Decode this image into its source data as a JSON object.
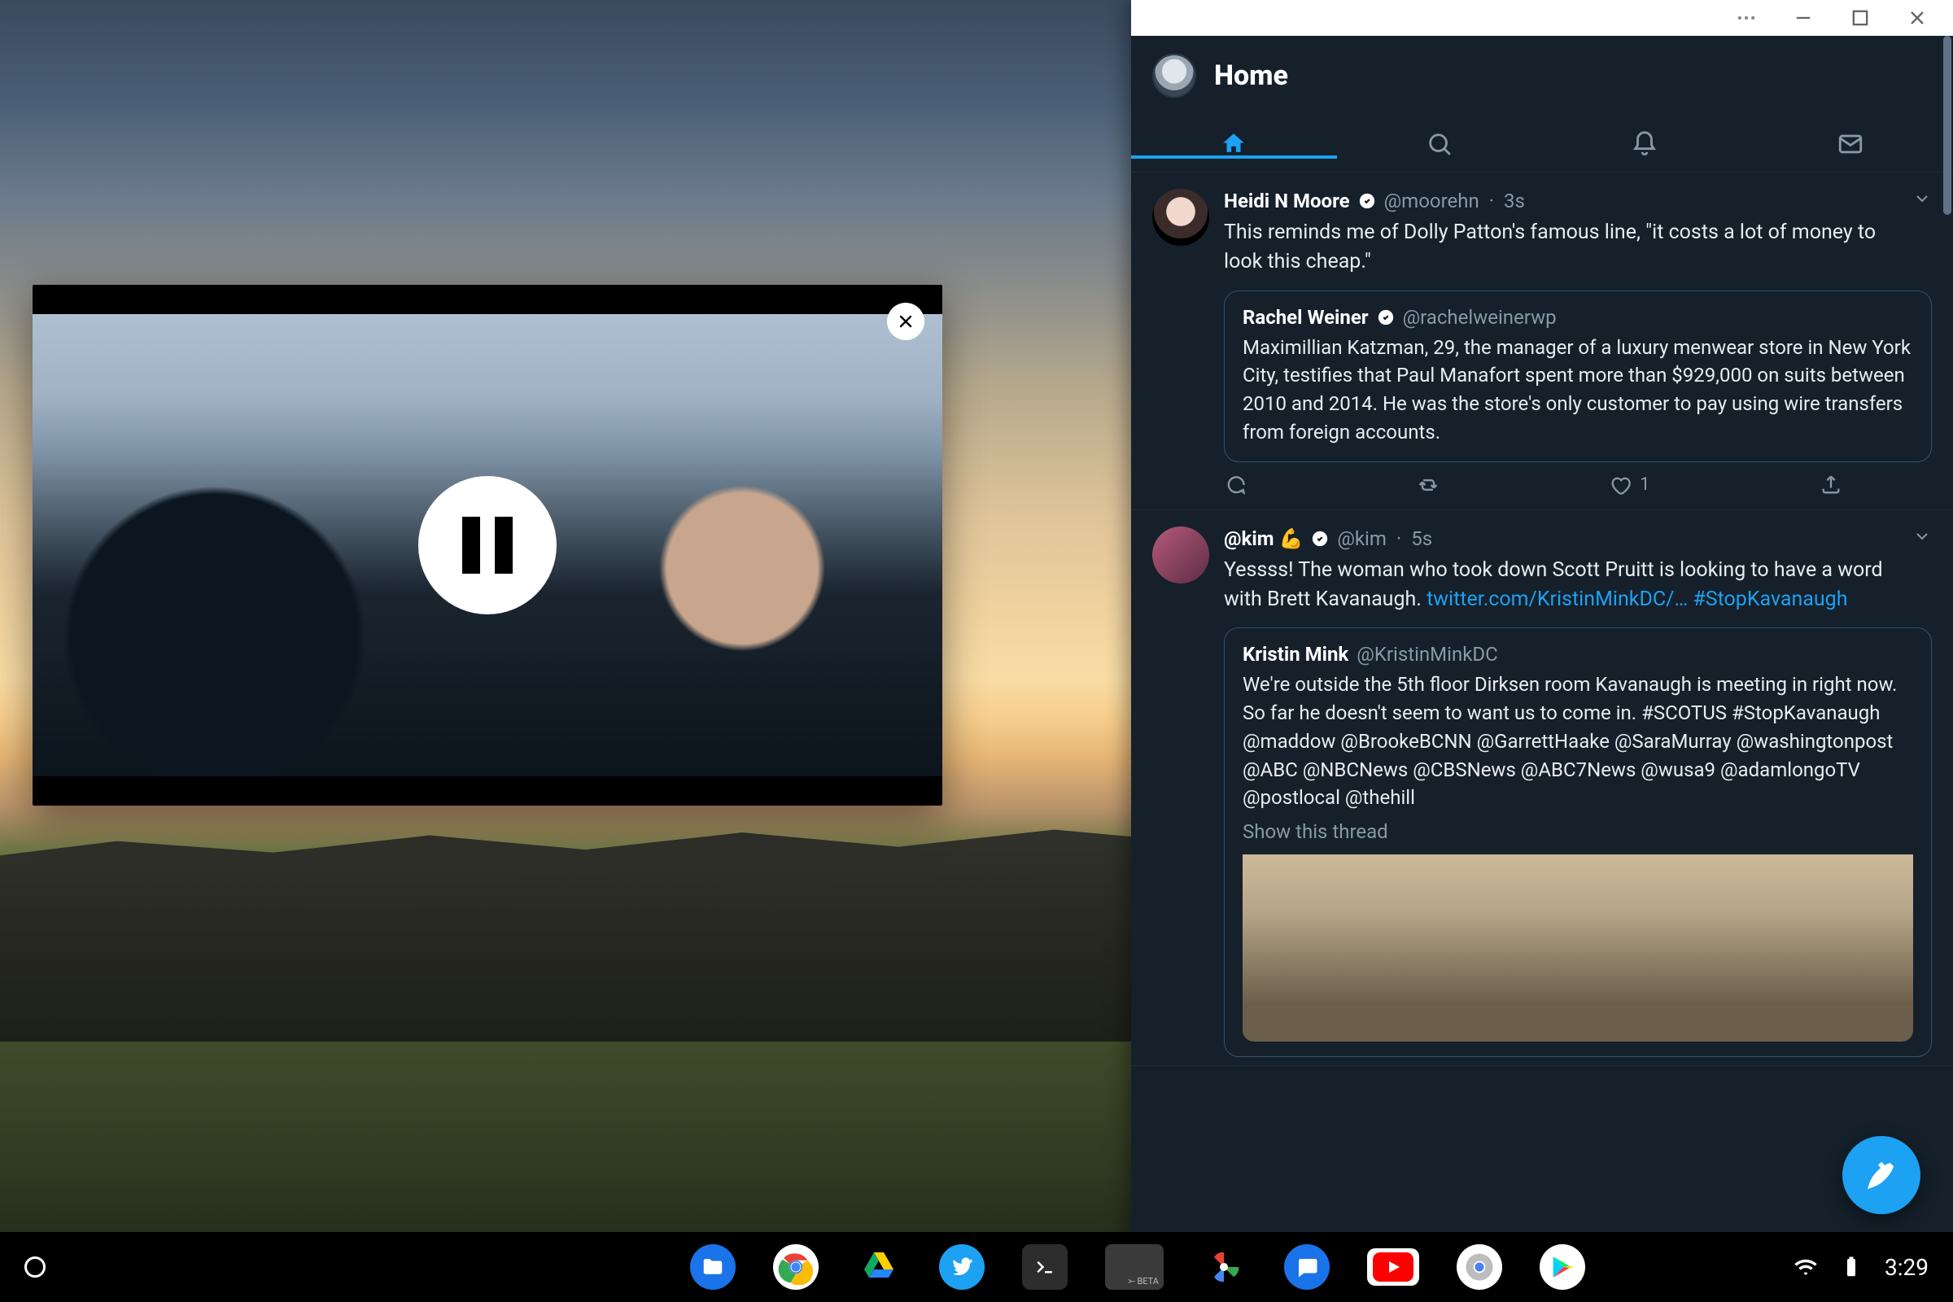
{
  "twitter": {
    "title": "Home",
    "tabs": {
      "home": "home-tab",
      "search": "search-tab",
      "notifications": "notifications-tab",
      "messages": "messages-tab"
    },
    "tweets": [
      {
        "author_name": "Heidi N Moore",
        "author_handle": "@moorehn",
        "time": "3s",
        "text": "This reminds me of Dolly Patton's famous line, \"it costs a lot of money to look this cheap.\"",
        "quote": {
          "author_name": "Rachel Weiner",
          "author_handle": "@rachelweinerwp",
          "text": "Maximillian Katzman, 29, the manager of a luxury menwear store in New York City, testifies that Paul Manafort spent more than $929,000 on suits between 2010 and 2014. He was the store's only customer to pay using wire transfers from foreign accounts."
        },
        "like_count": "1"
      },
      {
        "author_name": "@kim 💪",
        "author_handle": "@kim",
        "time": "5s",
        "text_prefix": "Yessss! The woman who took down Scott Pruitt is looking to have a word with Brett Kavanaugh. ",
        "link": "twitter.com/KristinMinkDC/…",
        "hashtag": "#StopKavanaugh",
        "quote": {
          "author_name": "Kristin Mink",
          "author_handle": "@KristinMinkDC",
          "text": "We're outside the 5th floor Dirksen room Kavanaugh is meeting in right now. So far he doesn't seem to want us to come in. #SCOTUS #StopKavanaugh\n@maddow @BrookeBCNN @GarrettHaake @SaraMurray @washingtonpost @ABC @NBCNews @CBSNews @ABC7News @wusa9 @adamlongoTV @postlocal @thehill",
          "show_thread": "Show this thread"
        }
      }
    ]
  },
  "pip": {
    "state": "paused"
  },
  "status": {
    "clock": "3:29"
  },
  "taskbar_apps": [
    "files",
    "chrome",
    "drive",
    "twitter",
    "terminal",
    "beta",
    "photos",
    "messages",
    "youtube",
    "chrome-canary",
    "play-store"
  ]
}
